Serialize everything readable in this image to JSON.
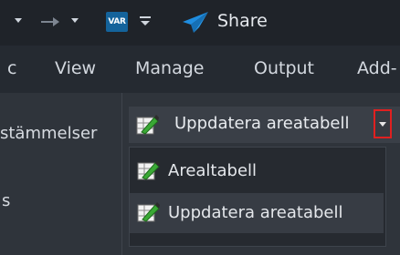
{
  "quick_access": {
    "var_icon_text": "VAR",
    "share_label": "Share"
  },
  "tabs": [
    "c",
    "View",
    "Manage",
    "Output",
    "Add-"
  ],
  "left_panel": {
    "label": "stämmelser",
    "fragment": "s"
  },
  "split_button": {
    "label": "Uppdatera areatabell"
  },
  "dropdown": {
    "items": [
      {
        "label": "Arealtabell"
      },
      {
        "label": "Uppdatera areatabell"
      }
    ]
  },
  "colors": {
    "accent_blue": "#1f8de0",
    "highlight_red": "#e02020"
  }
}
